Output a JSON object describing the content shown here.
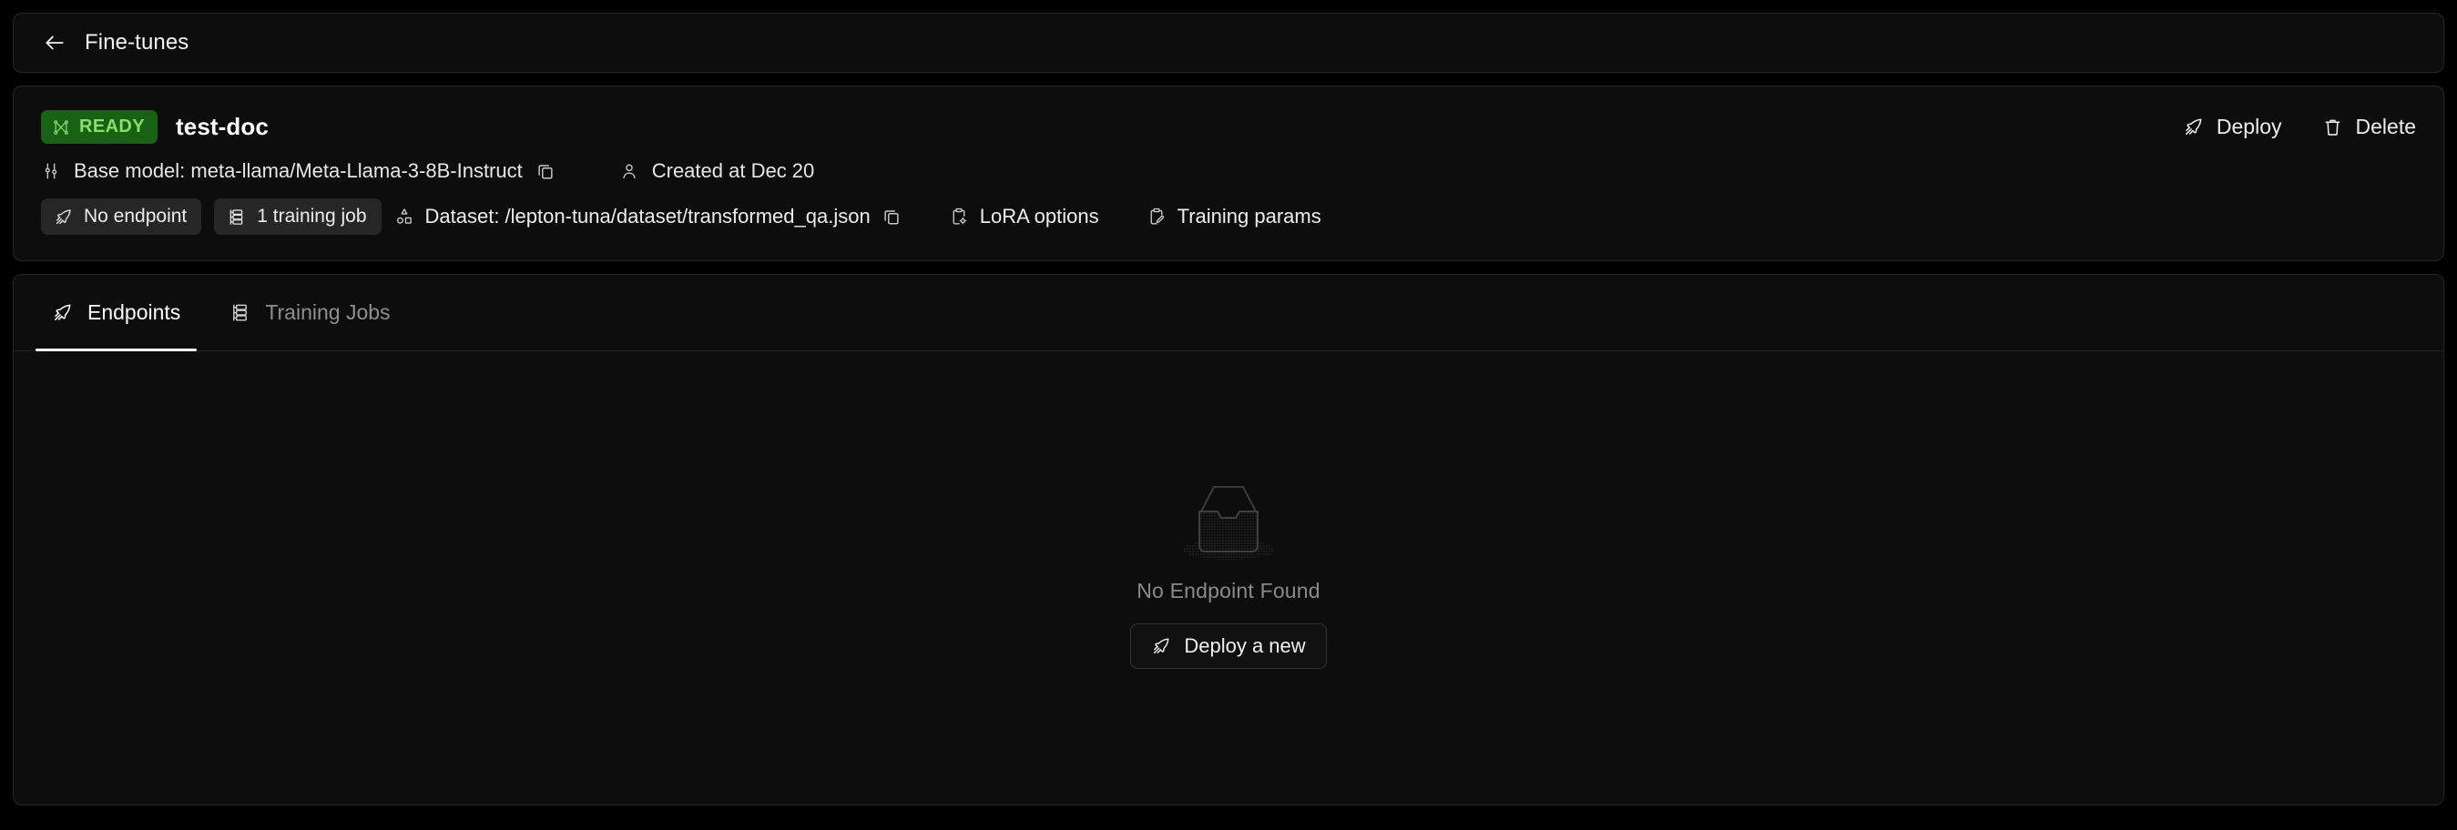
{
  "header": {
    "back_label": "Fine-tunes",
    "back_icon": "arrow-left-icon"
  },
  "summary": {
    "status": {
      "label": "READY",
      "icon": "fine-tune-graph-icon",
      "bg_color": "#196114",
      "text_color": "#86e06a"
    },
    "name": "test-doc",
    "actions": [
      {
        "label": "Deploy",
        "icon": "rocket-icon"
      },
      {
        "label": "Delete",
        "icon": "trash-icon"
      }
    ],
    "meta": {
      "base_model_icon": "sliders-icon",
      "base_model_label": "Base model: meta-llama/Meta-Llama-3-8B-Instruct",
      "base_model_copy_icon": "copy-icon",
      "created_icon": "user-icon",
      "created_label": "Created at Dec 20"
    },
    "tags": {
      "endpoint_pill": {
        "label": "No endpoint",
        "icon": "rocket-icon"
      },
      "training_job_pill": {
        "label": "1 training job",
        "icon": "server-list-icon"
      },
      "dataset": {
        "icon": "shapes-icon",
        "label": "Dataset: /lepton-tuna/dataset/transformed_qa.json",
        "copy_icon": "copy-icon"
      },
      "lora_options": {
        "label": "LoRA options",
        "icon": "clipboard-gear-icon"
      },
      "training_params": {
        "label": "Training params",
        "icon": "clipboard-pen-icon"
      }
    }
  },
  "content": {
    "tabs": [
      {
        "label": "Endpoints",
        "icon": "rocket-icon",
        "active": true
      },
      {
        "label": "Training Jobs",
        "icon": "server-list-icon",
        "active": false
      }
    ],
    "empty_state": {
      "illustration": "empty-inbox-tray-icon",
      "message": "No Endpoint Found",
      "button": {
        "label": "Deploy a new",
        "icon": "rocket-icon"
      }
    }
  }
}
